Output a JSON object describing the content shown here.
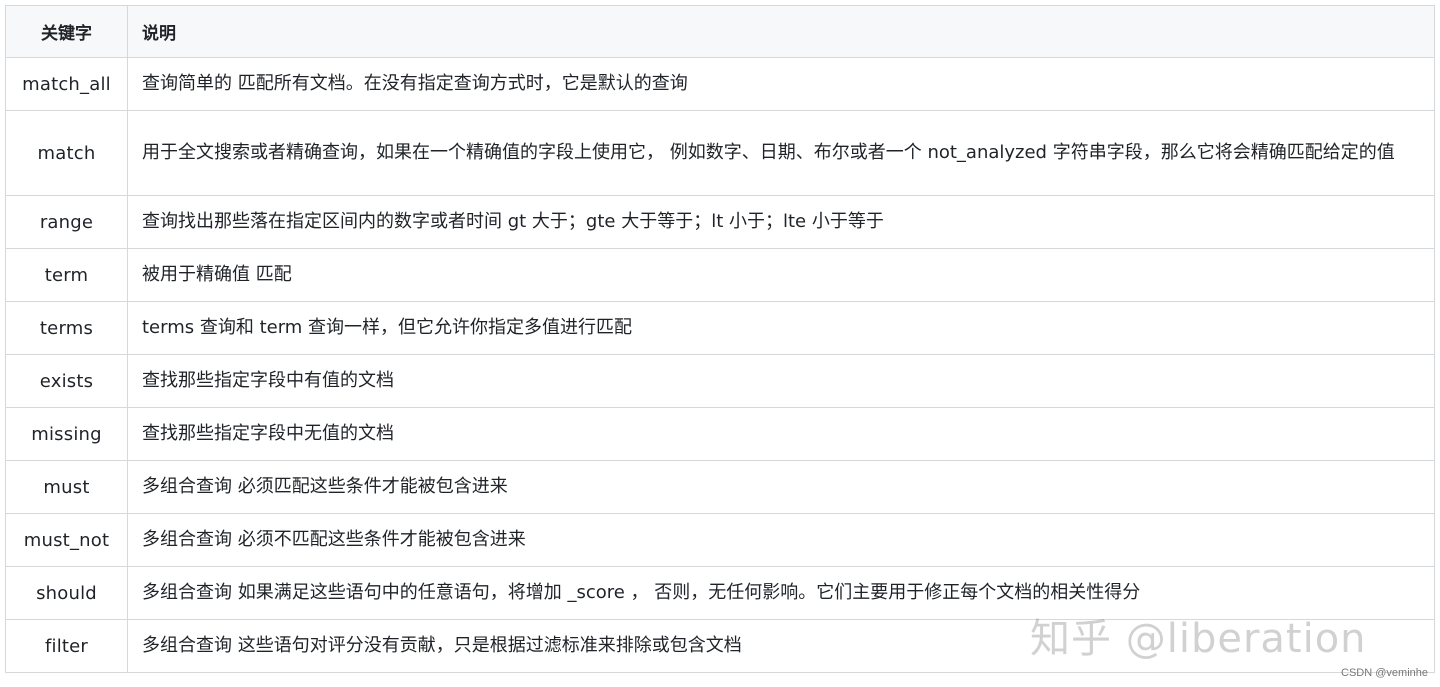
{
  "table": {
    "headers": [
      "关键字",
      "说明"
    ],
    "rows": [
      {
        "keyword": "match_all",
        "description": "查询简单的 匹配所有文档。在没有指定查询方式时，它是默认的查询"
      },
      {
        "keyword": "match",
        "description": "用于全文搜索或者精确查询，如果在一个精确值的字段上使用它， 例如数字、日期、布尔或者一个 not_analyzed 字符串字段，那么它将会精确匹配给定的值"
      },
      {
        "keyword": "range",
        "description": "查询找出那些落在指定区间内的数字或者时间 gt 大于；gte 大于等于；lt 小于；lte 小于等于"
      },
      {
        "keyword": "term",
        "description": "被用于精确值 匹配"
      },
      {
        "keyword": "terms",
        "description": "terms 查询和 term 查询一样，但它允许你指定多值进行匹配"
      },
      {
        "keyword": "exists",
        "description": "查找那些指定字段中有值的文档"
      },
      {
        "keyword": "missing",
        "description": "查找那些指定字段中无值的文档"
      },
      {
        "keyword": "must",
        "description": "多组合查询 必须匹配这些条件才能被包含进来"
      },
      {
        "keyword": "must_not",
        "description": "多组合查询 必须不匹配这些条件才能被包含进来"
      },
      {
        "keyword": "should",
        "description": "多组合查询 如果满足这些语句中的任意语句，将增加 _score ， 否则，无任何影响。它们主要用于修正每个文档的相关性得分"
      },
      {
        "keyword": "filter",
        "description": "多组合查询 这些语句对评分没有贡献，只是根据过滤标准来排除或包含文档"
      }
    ]
  },
  "watermark": "知乎 @liberation",
  "credit": "CSDN @veminhe"
}
